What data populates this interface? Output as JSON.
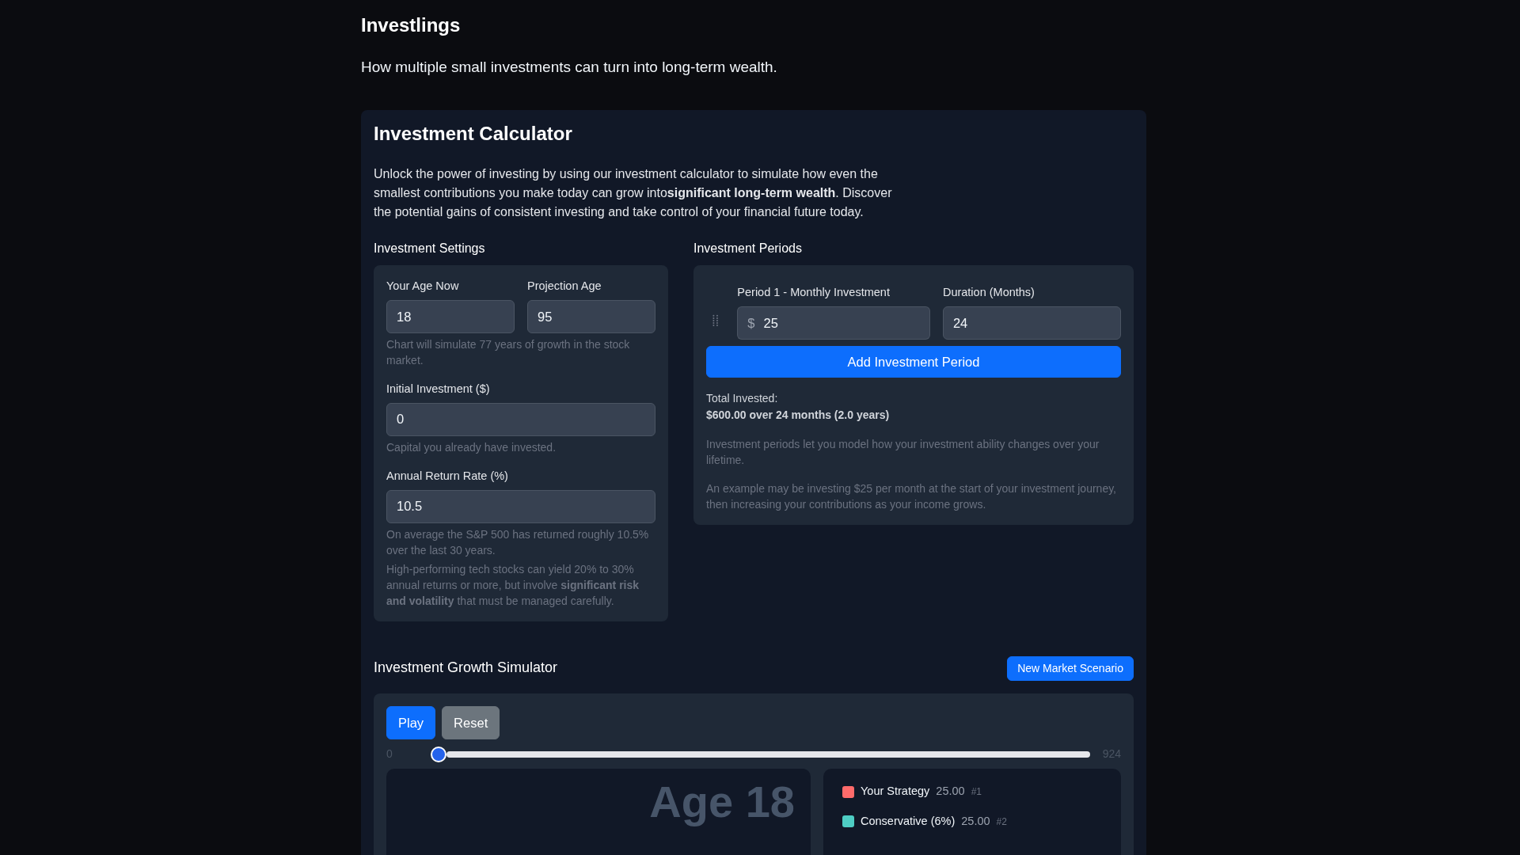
{
  "header": {
    "title": "Investlings",
    "tagline": "How multiple small investments can turn into long-term wealth."
  },
  "calculator": {
    "title": "Investment Calculator",
    "intro": "Unlock the power of investing by using our investment calculator to simulate how even the smallest contributions you make today can grow into**significant long-term wealth**. Discover the potential gains of consistent investing and take control of your financial future today.",
    "settings": {
      "heading": "Investment Settings",
      "age_now": {
        "label": "Your Age Now",
        "value": "18"
      },
      "projection_age": {
        "label": "Projection Age",
        "value": "95"
      },
      "age_help": "Chart will simulate 77 years of growth in the stock market.",
      "initial": {
        "label": "Initial Investment ($)",
        "value": "0"
      },
      "initial_help": "Capital you already have invested.",
      "rate": {
        "label": "Annual Return Rate (%)",
        "value": "10.5"
      },
      "rate_help": "On average the S&P 500 has returned roughly 10.5% over the last 30 years.",
      "rate_note": "High-performing tech stocks can yield 20% to 30% annual returns or more, but involve **significant risk and volatility** that must be managed carefully."
    },
    "periods": {
      "heading": "Investment Periods",
      "items": [
        {
          "amount_label": "Period 1 - Monthly Investment",
          "prefix": "$",
          "amount": "25",
          "duration_label": "Duration (Months)",
          "duration": "24"
        }
      ],
      "add_button": "Add Investment Period",
      "total_label": "Total Invested:",
      "total_value": "$600.00 over 24 months (2.0 years)",
      "notes": [
        "Investment periods let you model how your investment ability changes over your lifetime.",
        "An example may be investing $25 per month at the start of your investment journey, then increasing your contributions as your income grows."
      ]
    }
  },
  "simulator": {
    "title": "Investment Growth Simulator",
    "scenario_button": "New Market Scenario",
    "play_button": "Play",
    "reset_button": "Reset",
    "slider": {
      "min": "0",
      "max": "924",
      "level": 0
    },
    "age_display": "Age 18",
    "legend": [
      {
        "name": "Your Strategy",
        "value": "25.00",
        "rank": "#1",
        "color": "#ff6b6b"
      },
      {
        "name": "Conservative (6%)",
        "value": "25.00",
        "rank": "#2",
        "color": "#4ecdc4"
      }
    ]
  }
}
